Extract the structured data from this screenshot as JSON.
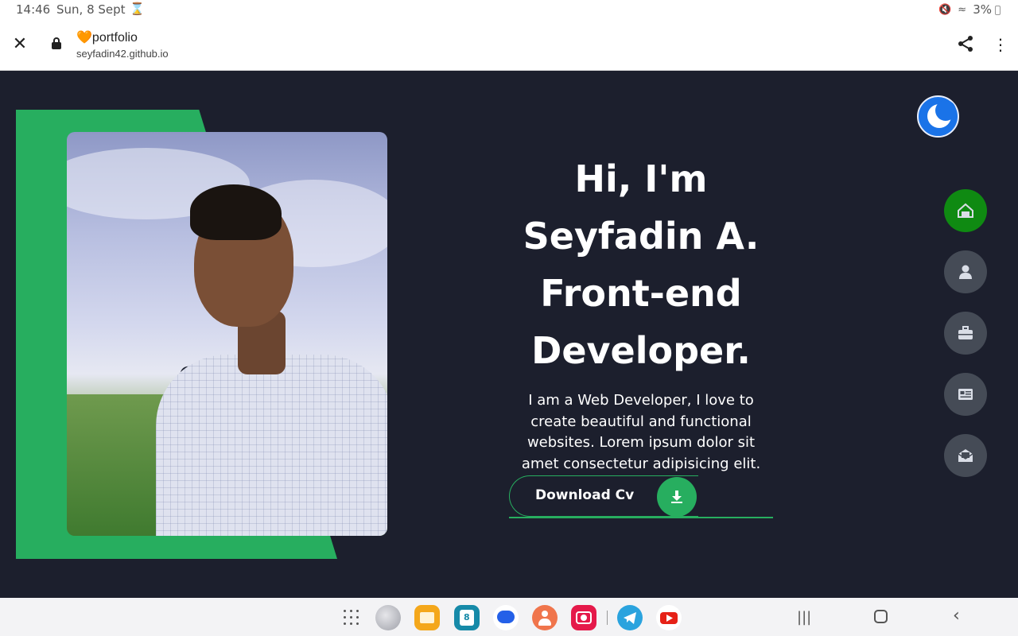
{
  "status_bar": {
    "time": "14:46",
    "date": "Sun, 8 Sept",
    "battery": "3%"
  },
  "browser": {
    "title": "portfolio",
    "url": "seyfadin42.github.io",
    "icons": [
      "close-icon",
      "lock-icon",
      "heart-icon",
      "share-icon",
      "more-vert-icon"
    ]
  },
  "hero": {
    "line1": "Hi, I'm",
    "line2": "Seyfadin A.",
    "line3": "Front-end",
    "line4": "Developer.",
    "description": "I am a Web Developer, I love to create beautiful and functional websites. Lorem ipsum dolor sit amet consectetur adipisicing elit.",
    "cv_button": "Download Cv"
  },
  "nav": {
    "items": [
      {
        "name": "home",
        "icon": "home-icon",
        "active": true
      },
      {
        "name": "about",
        "icon": "user-icon",
        "active": false
      },
      {
        "name": "portfolio",
        "icon": "briefcase-icon",
        "active": false
      },
      {
        "name": "blog",
        "icon": "newspaper-icon",
        "active": false
      },
      {
        "name": "contact",
        "icon": "mail-open-icon",
        "active": false
      }
    ]
  },
  "theme_toggle": {
    "icon": "moon-icon"
  },
  "dock": {
    "apps": [
      "apps-grid-icon",
      "internet-icon",
      "files-icon",
      "calendar-icon",
      "messages-icon",
      "contacts-icon",
      "camera-icon",
      "telegram-icon",
      "youtube-icon"
    ],
    "calendar_day": "8",
    "nav_buttons": [
      "recents-icon",
      "home-icon",
      "back-icon"
    ]
  },
  "colors": {
    "page_bg": "#1c1f2d",
    "accent_green": "#27ae5f",
    "nav_active": "#0f8a12",
    "nav_inactive": "#454b56",
    "toggle_blue": "#1a73e8"
  }
}
